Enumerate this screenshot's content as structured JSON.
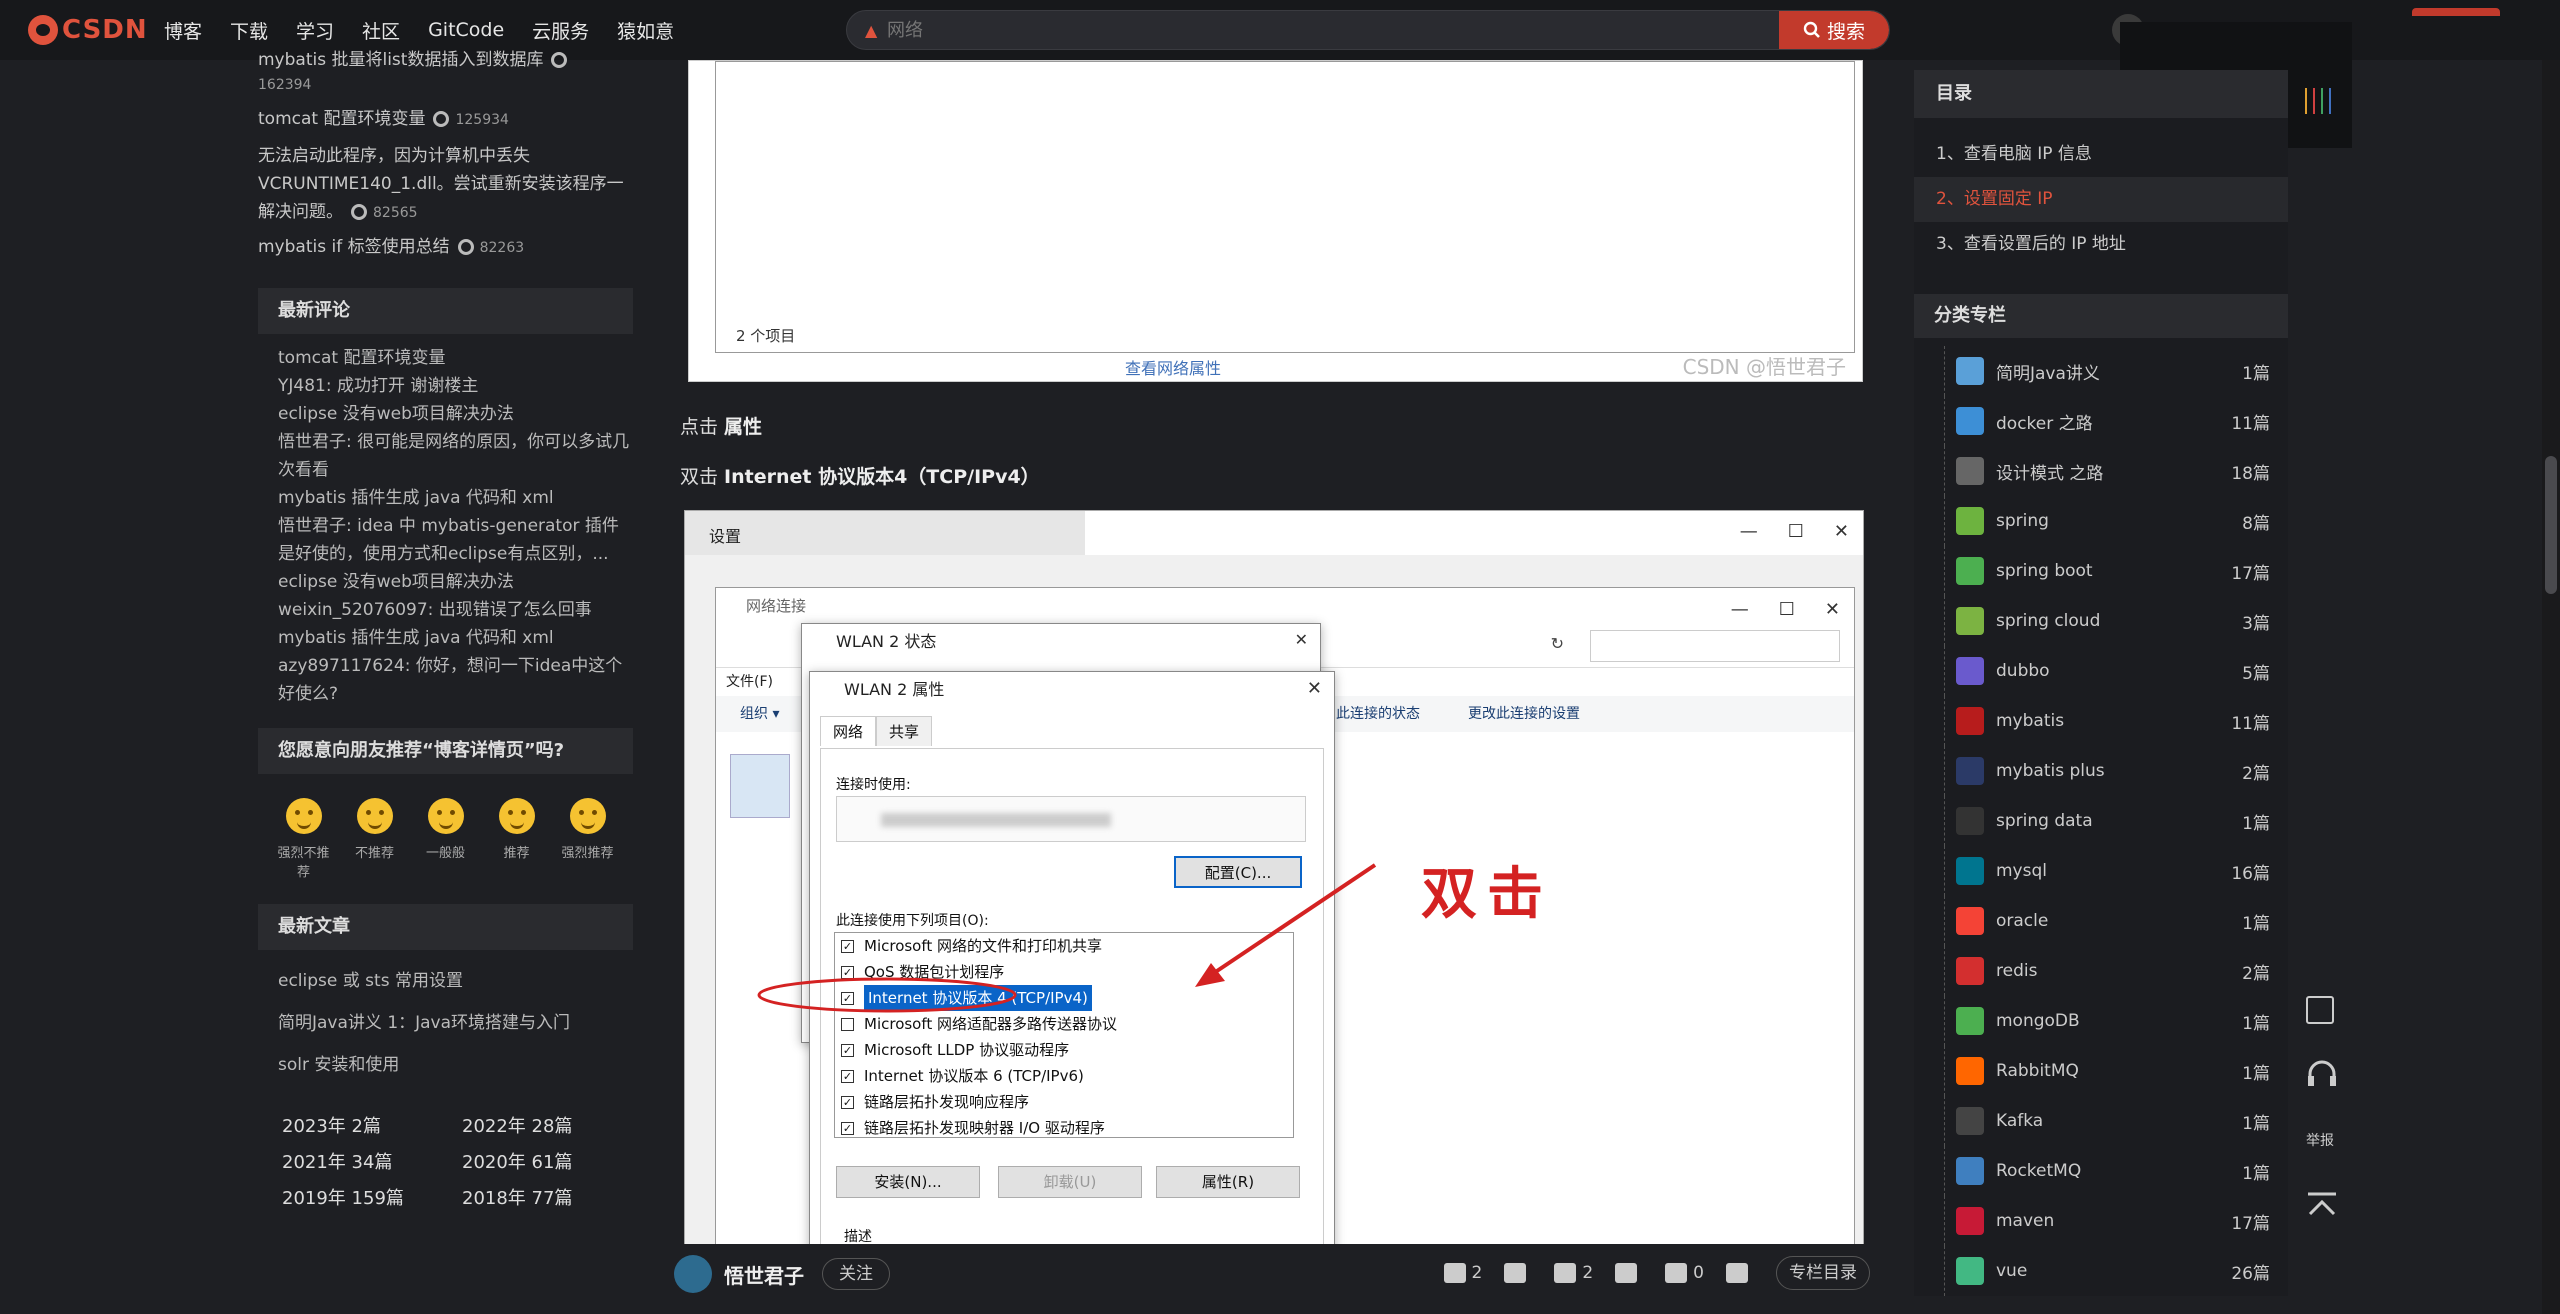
{
  "topbar": {
    "logo_text": "CSDN",
    "nav": [
      "博客",
      "下载",
      "学习",
      "社区",
      "GitCode",
      "云服务",
      "猿如意"
    ],
    "search_placeholder": "网络",
    "search_btn": "搜索"
  },
  "left": {
    "popular": [
      {
        "title": "mybatis 批量将list数据插入到数据库",
        "views": "162394"
      },
      {
        "title": "tomcat 配置环境变量",
        "views": "125934"
      },
      {
        "title": "无法启动此程序，因为计算机中丢失VCRUNTIME140_1.dll。尝试重新安装该程序一解决问题。",
        "views": "82565"
      },
      {
        "title": "mybatis if 标签使用总结",
        "views": "82263"
      }
    ],
    "comments_header": "最新评论",
    "comments": [
      {
        "post": "tomcat 配置环境变量",
        "text": "YJ481: 成功打开 谢谢楼主"
      },
      {
        "post": "eclipse 没有web项目解决办法",
        "text": "悟世君子: 很可能是网络的原因，你可以多试几次看看"
      },
      {
        "post": "mybatis 插件生成 java 代码和 xml",
        "text": "悟世君子: idea 中 mybatis-generator 插件是好使的，使用方式和eclipse有点区别，..."
      },
      {
        "post": "eclipse 没有web项目解决办法",
        "text": "weixin_52076097: 出现错误了怎么回事"
      },
      {
        "post": "mybatis 插件生成 java 代码和 xml",
        "text": "azy897117624: 你好，想问一下idea中这个好使么?"
      }
    ],
    "recommend_header": "您愿意向朋友推荐“博客详情页”吗?",
    "emotions": [
      "强烈不推荐",
      "不推荐",
      "一般般",
      "推荐",
      "强烈推荐"
    ],
    "recent_header": "最新文章",
    "recent": [
      "eclipse 或 sts 常用设置",
      "简明Java讲义 1：Java环境搭建与入门",
      "solr 安装和使用"
    ],
    "archive": [
      {
        "year": "2023年",
        "count": "2篇"
      },
      {
        "year": "2022年",
        "count": "28篇"
      },
      {
        "year": "2021年",
        "count": "34篇"
      },
      {
        "year": "2020年",
        "count": "61篇"
      },
      {
        "year": "2019年",
        "count": "159篇"
      },
      {
        "year": "2018年",
        "count": "77篇"
      }
    ]
  },
  "main": {
    "shot1": {
      "count": "2 个项目",
      "link": "查看网络属性",
      "watermark": "CSDN @悟世君子"
    },
    "para1_prefix": "点击 ",
    "para1_bold": "属性",
    "para2_prefix": "双击 ",
    "para2_bold": "Internet 协议版本4（TCP/IPv4）",
    "shot2": {
      "settings_title": "设置",
      "netconn_title": "网络连接",
      "menu_file": "文件(F)",
      "organize": "组织 ▾",
      "status_title": "WLAN 2 状态",
      "props_title": "WLAN 2 属性",
      "tab_net": "网络",
      "tab_share": "共享",
      "connect_using": "连接时使用:",
      "config_btn": "配置(C)...",
      "items_label": "此连接使用下列项目(O):",
      "items": [
        {
          "checked": true,
          "label": "Microsoft 网络的文件和打印机共享"
        },
        {
          "checked": true,
          "label": "QoS 数据包计划程序"
        },
        {
          "checked": true,
          "label": "Internet 协议版本 4 (TCP/IPv4)",
          "selected": true
        },
        {
          "checked": false,
          "label": "Microsoft 网络适配器多路传送器协议"
        },
        {
          "checked": true,
          "label": "Microsoft LLDP 协议驱动程序"
        },
        {
          "checked": true,
          "label": "Internet 协议版本 6 (TCP/IPv6)"
        },
        {
          "checked": true,
          "label": "链路层拓扑发现响应程序"
        },
        {
          "checked": true,
          "label": "链路层拓扑发现映射器 I/O 驱动程序"
        }
      ],
      "install_btn": "安装(N)...",
      "uninstall_btn": "卸载(U)",
      "props_btn": "属性(R)",
      "desc_label": "描述",
      "toolbar_status": "此连接的状态",
      "toolbar_change": "更改此连接的设置",
      "annotation": "双击"
    }
  },
  "bottom": {
    "author": "悟世君子",
    "follow": "关注",
    "likes": "2",
    "favs": "2",
    "comments": "0",
    "column_btn": "专栏目录"
  },
  "toc": {
    "header": "目录",
    "items": [
      "1、查看电脑 IP 信息",
      "2、设置固定 IP",
      "3、查看设置后的 IP 地址"
    ]
  },
  "category": {
    "header": "分类专栏",
    "items": [
      {
        "name": "简明Java讲义",
        "count": "1篇",
        "color": "#5aa0d8"
      },
      {
        "name": "docker 之路",
        "count": "11篇",
        "color": "#3d8fd6"
      },
      {
        "name": "设计模式 之路",
        "count": "18篇",
        "color": "#666666"
      },
      {
        "name": "spring",
        "count": "8篇",
        "color": "#6db33f"
      },
      {
        "name": "spring boot",
        "count": "17篇",
        "color": "#4caf50"
      },
      {
        "name": "spring cloud",
        "count": "3篇",
        "color": "#7cb342"
      },
      {
        "name": "dubbo",
        "count": "5篇",
        "color": "#6a5acd"
      },
      {
        "name": "mybatis",
        "count": "11篇",
        "color": "#b71c1c"
      },
      {
        "name": "mybatis plus",
        "count": "2篇",
        "color": "#2b3a67"
      },
      {
        "name": "spring data",
        "count": "1篇",
        "color": "#333333"
      },
      {
        "name": "mysql",
        "count": "16篇",
        "color": "#00758f"
      },
      {
        "name": "oracle",
        "count": "1篇",
        "color": "#f44336"
      },
      {
        "name": "redis",
        "count": "2篇",
        "color": "#d32f2f"
      },
      {
        "name": "mongoDB",
        "count": "1篇",
        "color": "#4caf50"
      },
      {
        "name": "RabbitMQ",
        "count": "1篇",
        "color": "#ff6600"
      },
      {
        "name": "Kafka",
        "count": "1篇",
        "color": "#444444"
      },
      {
        "name": "RocketMQ",
        "count": "1篇",
        "color": "#3f7fbf"
      },
      {
        "name": "maven",
        "count": "17篇",
        "color": "#c71a36"
      },
      {
        "name": "vue",
        "count": "26篇",
        "color": "#42b883"
      }
    ]
  },
  "floating": {
    "report": "举报"
  }
}
